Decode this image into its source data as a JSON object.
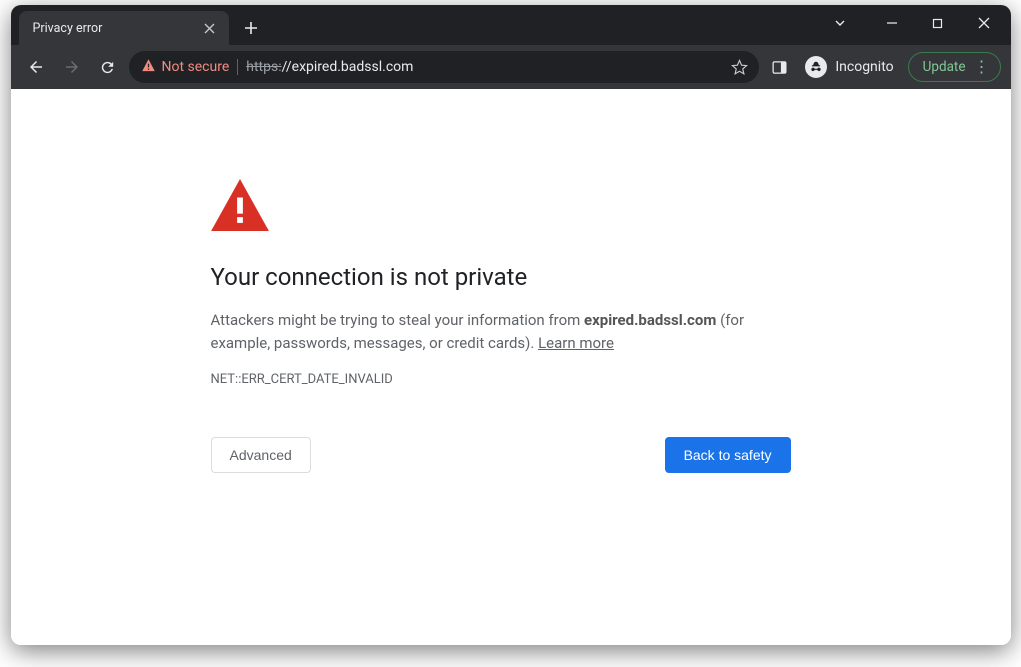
{
  "tab": {
    "title": "Privacy error"
  },
  "omnibox": {
    "not_secure_label": "Not secure",
    "url_struck": "https:",
    "url_rest": "//expired.badssl.com"
  },
  "toolbar": {
    "incognito_label": "Incognito",
    "update_label": "Update"
  },
  "interstitial": {
    "heading": "Your connection is not private",
    "body_prefix": "Attackers might be trying to steal your information from ",
    "body_domain": "expired.badssl.com",
    "body_suffix": " (for example, passwords, messages, or credit cards). ",
    "learn_more": "Learn more",
    "error_code": "NET::ERR_CERT_DATE_INVALID",
    "advanced_label": "Advanced",
    "back_label": "Back to safety"
  }
}
